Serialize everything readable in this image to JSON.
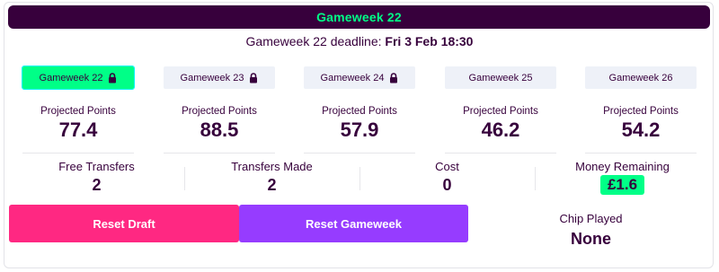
{
  "header": {
    "title": "Gameweek 22"
  },
  "deadline": {
    "prefix": "Gameweek 22 deadline:",
    "value": "Fri 3 Feb 18:30"
  },
  "gameweeks": [
    {
      "label": "Gameweek 22",
      "locked": true,
      "active": true,
      "projected_label": "Projected Points",
      "projected": "77.4"
    },
    {
      "label": "Gameweek 23",
      "locked": true,
      "active": false,
      "projected_label": "Projected Points",
      "projected": "88.5"
    },
    {
      "label": "Gameweek 24",
      "locked": true,
      "active": false,
      "projected_label": "Projected Points",
      "projected": "57.9"
    },
    {
      "label": "Gameweek 25",
      "locked": false,
      "active": false,
      "projected_label": "Projected Points",
      "projected": "46.2"
    },
    {
      "label": "Gameweek 26",
      "locked": false,
      "active": false,
      "projected_label": "Projected Points",
      "projected": "54.2"
    }
  ],
  "stats": {
    "free_transfers": {
      "label": "Free Transfers",
      "value": "2"
    },
    "transfers_made": {
      "label": "Transfers Made",
      "value": "2"
    },
    "cost": {
      "label": "Cost",
      "value": "0"
    },
    "money_remaining": {
      "label": "Money Remaining",
      "value": "£1.6"
    }
  },
  "actions": {
    "reset_draft": "Reset Draft",
    "reset_gameweek": "Reset Gameweek"
  },
  "chip": {
    "label": "Chip Played",
    "value": "None"
  },
  "colors": {
    "primary": "#37003c",
    "accent_green": "#00ff87",
    "pink": "#ff2882",
    "purple": "#963cff"
  },
  "icons": {
    "lock": "lock-icon"
  }
}
